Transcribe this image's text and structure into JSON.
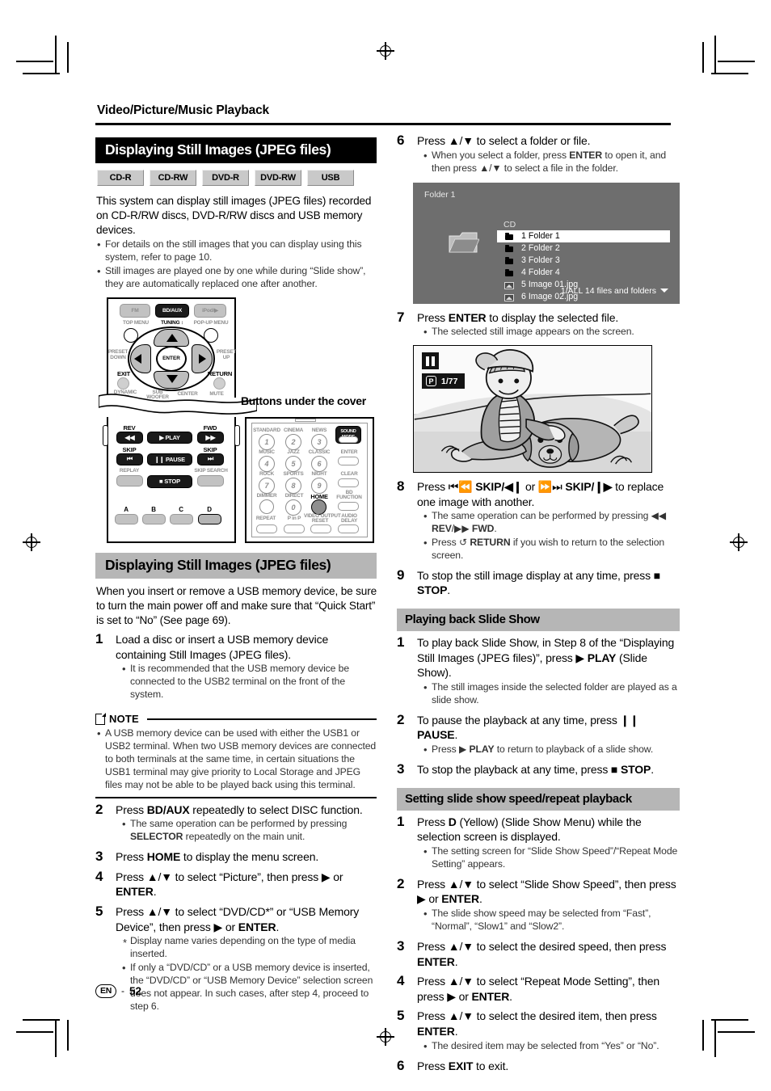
{
  "page": {
    "chapter_title": "Video/Picture/Music Playback",
    "footer_locale": "EN",
    "footer_dash": "-",
    "footer_page": "52"
  },
  "section1": {
    "header": "Displaying Still Images (JPEG files)",
    "media_badges": [
      "CD-R",
      "CD-RW",
      "DVD-R",
      "DVD-RW",
      "USB"
    ],
    "intro": "This system can display still images (JPEG files) recorded on CD-R/RW discs, DVD-R/RW discs and USB memory devices.",
    "bullets": [
      "For details on the still images that you can display using this system, refer to page 10.",
      "Still images are played one by one while during “Slide show”, they are automatically replaced one after another."
    ]
  },
  "remote": {
    "cover_label": "Buttons under the cover",
    "top_buttons": [
      {
        "label": "FM",
        "state": "grey"
      },
      {
        "label": "BD/AUX",
        "state": "dark"
      },
      {
        "label": "iPod/▶",
        "state": "grey"
      }
    ],
    "top_labels": [
      "TOP MENU",
      "TUNING ↕",
      "POP-UP MENU"
    ],
    "dpad": {
      "center": "ENTER",
      "left_label": "PRESET\nDOWN",
      "right_label": "PRESET\nUP",
      "exit": "EXIT",
      "return": "RETURN"
    },
    "under_cover_labels": [
      "DYNAMIC\nVOL",
      "SUB\nWOOFER",
      "CENTER",
      "MUTE"
    ],
    "transport": {
      "rev": "REV",
      "fwd": "FWD",
      "play": "▶ PLAY",
      "pause": "❙❙ PAUSE",
      "stop": "■ STOP",
      "skip_left": "SKIP",
      "skip_right": "SKIP",
      "replay": "REPLAY",
      "skip_search": "SKIP SEARCH"
    },
    "color_buttons": [
      "A",
      "B",
      "C",
      "D"
    ],
    "keypad": {
      "mode_labels": [
        "STANDARD",
        "CINEMA",
        "NEWS",
        "MUSIC",
        "JAZZ",
        "CLASSIC",
        "ROCK",
        "SPORTS",
        "NIGHT",
        "DIMMER",
        "DIRECT",
        "HOME"
      ],
      "numbers": [
        "1",
        "2",
        "3",
        "4",
        "5",
        "6",
        "7",
        "8",
        "9",
        "0"
      ],
      "right_column": [
        "SOUND MODE",
        "ENTER",
        "CLEAR",
        "BD FUNCTION",
        "AUDIO DELAY"
      ],
      "bottom_labels": [
        "REPEAT",
        "P in P",
        "VIDEO OUTPUT RESET"
      ],
      "home": "HOME"
    }
  },
  "section2": {
    "header": "Displaying Still Images (JPEG files)",
    "intro": "When you insert or remove a USB memory device, be sure to turn the main power off and make sure that “Quick Start” is set to “No” (See page 69).",
    "steps": [
      {
        "num": "1",
        "text": "Load a disc or insert a USB memory device containing Still Images (JPEG files).",
        "bullets": [
          "It is recommended that the USB memory device be connected to the USB2 terminal on the front of the system."
        ]
      },
      {
        "num": "2",
        "text_html": "Press <b>BD/AUX</b> repeatedly to select DISC function.",
        "bullets_html": [
          "The same operation can be performed by pressing <b>SELECTOR</b> repeatedly on the main unit."
        ]
      },
      {
        "num": "3",
        "text_html": "Press <b>HOME</b> to display the menu screen.",
        "bullets_html": []
      },
      {
        "num": "4",
        "text_html": "Press ▲/▼ to select “Picture”, then press ▶ or <b>ENTER</b>.",
        "bullets_html": []
      },
      {
        "num": "5",
        "text_html": "Press ▲/▼ to select “DVD/CD*” or “USB Memory Device”, then press ▶ or <b>ENTER</b>.",
        "bullets_html": [
          "Display name varies depending on the type of media inserted.",
          "If only a “DVD/CD” or a USB memory device is inserted, the “DVD/CD” or “USB Memory Device” selection screen does not appear. In such cases, after step 4, proceed to step 6."
        ]
      }
    ],
    "note": {
      "label": "NOTE",
      "bullets": [
        "A USB memory device can be used with either the USB1 or USB2 terminal. When two USB memory devices are connected to both terminals at the same time, in certain situations the USB1 terminal may give priority to Local Storage and JPEG files may not be able to be played back using this terminal."
      ]
    }
  },
  "section3": {
    "steps": [
      {
        "num": "6",
        "text": "Press ▲/▼ to select a folder or file.",
        "bullets_html": [
          "When you select a folder, press <b>ENTER</b> to open it, and then press ▲/▼ to select a file in the folder."
        ]
      },
      {
        "num": "7",
        "text_html": "Press <b>ENTER</b> to display the selected file.",
        "bullets_html": [
          "The selected still image appears on the screen."
        ]
      },
      {
        "num": "8",
        "text_html": "Press ⏮⏪ <b>SKIP/◀❙</b> or ⏩⏭ <b>SKIP/❙▶</b> to replace one image with another.",
        "bullets_html": [
          "The same operation can be performed by pressing ◀◀ <b>REV</b>/▶▶ <b>FWD</b>.",
          "Press ↺ <b>RETURN</b> if you wish to return to the selection screen."
        ]
      },
      {
        "num": "9",
        "text_html": "To stop the still image display at any time, press ■ <b>STOP</b>.",
        "bullets_html": []
      }
    ]
  },
  "osd": {
    "title": "Folder 1",
    "source_label": "CD",
    "items": [
      {
        "index": "1",
        "name": "Folder 1",
        "type": "folder",
        "selected": true
      },
      {
        "index": "2",
        "name": "Folder 2",
        "type": "folder",
        "selected": false
      },
      {
        "index": "3",
        "name": "Folder 3",
        "type": "folder",
        "selected": false
      },
      {
        "index": "4",
        "name": "Folder 4",
        "type": "folder",
        "selected": false
      },
      {
        "index": "5",
        "name": "Image 01.jpg",
        "type": "image",
        "selected": false
      },
      {
        "index": "6",
        "name": "Image 02.jpg",
        "type": "image",
        "selected": false
      }
    ],
    "footer": "1/ALL  14 files and folders"
  },
  "photo": {
    "pause_badge": "pause-icon",
    "p_badge_letter": "P",
    "counter": "1/77"
  },
  "section4": {
    "header": "Playing back Slide Show",
    "steps": [
      {
        "num": "1",
        "text_html": "To play back Slide Show, in Step 8 of the “Displaying Still Images (JPEG files)”, press ▶ <b>PLAY</b> (Slide Show).",
        "bullets_html": [
          "The still images inside the selected folder are played as a slide show."
        ]
      },
      {
        "num": "2",
        "text_html": "To pause the playback at any time, press ❙❙ <b>PAUSE</b>.",
        "bullets_html": [
          "Press ▶ <b>PLAY</b> to return to playback of a slide show."
        ]
      },
      {
        "num": "3",
        "text_html": "To stop the playback at any time, press ■ <b>STOP</b>.",
        "bullets_html": []
      }
    ]
  },
  "section5": {
    "header": "Setting slide show speed/repeat playback",
    "steps": [
      {
        "num": "1",
        "text_html": "Press <b>D</b> (Yellow) (Slide Show Menu) while the selection screen is displayed.",
        "bullets_html": [
          "The setting screen for “Slide Show Speed”/“Repeat Mode Setting” appears."
        ]
      },
      {
        "num": "2",
        "text_html": "Press ▲/▼ to select “Slide Show Speed”, then press ▶ or <b>ENTER</b>.",
        "bullets_html": [
          "The slide show speed may be selected from “Fast”, “Normal”, “Slow1” and “Slow2”."
        ]
      },
      {
        "num": "3",
        "text_html": "Press ▲/▼ to select the desired speed, then press <b>ENTER</b>.",
        "bullets_html": []
      },
      {
        "num": "4",
        "text_html": "Press ▲/▼ to select “Repeat Mode Setting”, then press ▶ or <b>ENTER</b>.",
        "bullets_html": []
      },
      {
        "num": "5",
        "text_html": "Press ▲/▼ to select the desired item, then press <b>ENTER</b>.",
        "bullets_html": [
          "The desired item may be selected from “Yes” or “No”."
        ]
      },
      {
        "num": "6",
        "text_html": "Press <b>EXIT</b> to exit.",
        "bullets_html": []
      }
    ]
  }
}
